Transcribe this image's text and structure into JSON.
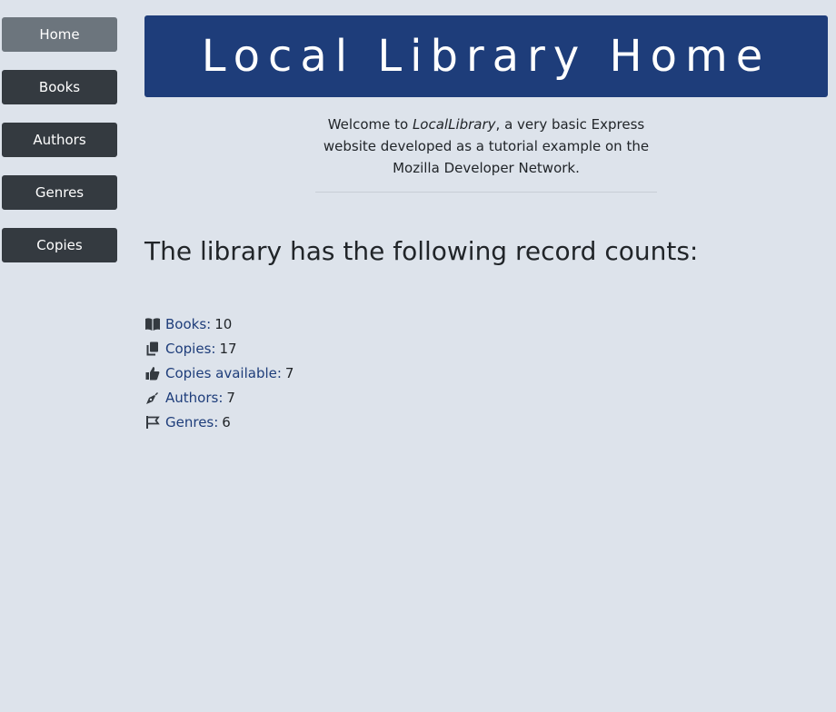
{
  "sidebar": {
    "items": [
      {
        "label": "Home",
        "active": true
      },
      {
        "label": "Books",
        "active": false
      },
      {
        "label": "Authors",
        "active": false
      },
      {
        "label": "Genres",
        "active": false
      },
      {
        "label": "Copies",
        "active": false
      }
    ]
  },
  "header": {
    "title": "Local Library Home"
  },
  "intro": {
    "prefix": "Welcome to ",
    "app_name": "LocalLibrary",
    "suffix": ", a very basic Express website developed as a tutorial example on the Mozilla Developer Network."
  },
  "counts": {
    "heading": "The library has the following record counts:",
    "items": [
      {
        "icon": "book-open-icon",
        "label": "Books:",
        "value": "10"
      },
      {
        "icon": "copy-icon",
        "label": "Copies:",
        "value": "17"
      },
      {
        "icon": "thumbs-up-icon",
        "label": "Copies available:",
        "value": "7"
      },
      {
        "icon": "pen-nib-icon",
        "label": "Authors:",
        "value": "7"
      },
      {
        "icon": "flag-icon",
        "label": "Genres:",
        "value": "6"
      }
    ]
  },
  "colors": {
    "background": "#dde3eb",
    "banner": "#1e3d7a",
    "nav": "#343a40",
    "nav_active": "#6c757d",
    "link": "#1e3d7a"
  }
}
